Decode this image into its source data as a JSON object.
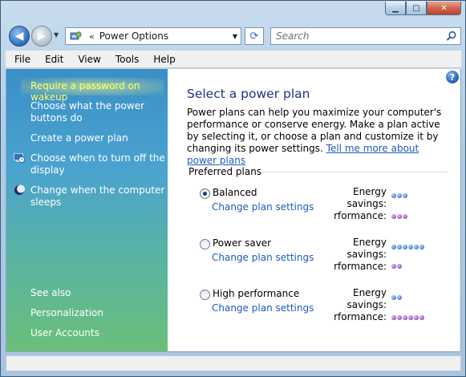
{
  "window": {
    "caption_buttons": {
      "minimize": "minimize-icon",
      "maximize": "maximize-icon",
      "close": "close-icon"
    }
  },
  "navigation": {
    "address_chevron": "«",
    "address_text": "Power Options",
    "search_placeholder": "Search"
  },
  "menubar": {
    "items": [
      "File",
      "Edit",
      "View",
      "Tools",
      "Help"
    ]
  },
  "taskpane": {
    "tasks": [
      {
        "label": "Require a password on wakeup",
        "highlighted": true
      },
      {
        "label_line1": "Choose what the power",
        "label_line2": "buttons do"
      },
      {
        "label": "Create a power plan"
      },
      {
        "label_line1": "Choose when to turn off the",
        "label_line2": "display",
        "icon": "monitor-clock-icon"
      },
      {
        "label_line1": "Change when the computer",
        "label_line2": "sleeps",
        "icon": "moon-icon"
      }
    ],
    "see_also": {
      "title": "See also",
      "links": [
        "Personalization",
        "User Accounts"
      ]
    }
  },
  "main": {
    "title": "Select a power plan",
    "intro_text": "Power plans can help you maximize your computer's performance or conserve energy. Make a plan active by selecting it, or choose a plan and customize it by changing its power settings.",
    "intro_link": "Tell me more about power plans",
    "group_title": "Preferred plans",
    "plans": [
      {
        "name": "Balanced",
        "selected": true,
        "link": "Change plan settings",
        "energy_label": "Energy",
        "savings_label": "savings:",
        "performance_label": "rformance:",
        "energy_savings_level": 3,
        "performance_level": 3
      },
      {
        "name": "Power saver",
        "selected": false,
        "link": "Change plan settings",
        "energy_label": "Energy",
        "savings_label": "savings:",
        "performance_label": "rformance:",
        "energy_savings_level": 6,
        "performance_level": 2
      },
      {
        "name": "High performance",
        "selected": false,
        "link": "Change plan settings",
        "energy_label": "Energy",
        "savings_label": "savings:",
        "performance_label": "rformance:",
        "energy_savings_level": 2,
        "performance_level": 6
      }
    ]
  },
  "colors": {
    "heading": "#1e3287",
    "link": "#1e5bbd",
    "highlight": "#ffff66",
    "energy_dot": "#3b75d6",
    "performance_dot": "#8a4cb5"
  }
}
